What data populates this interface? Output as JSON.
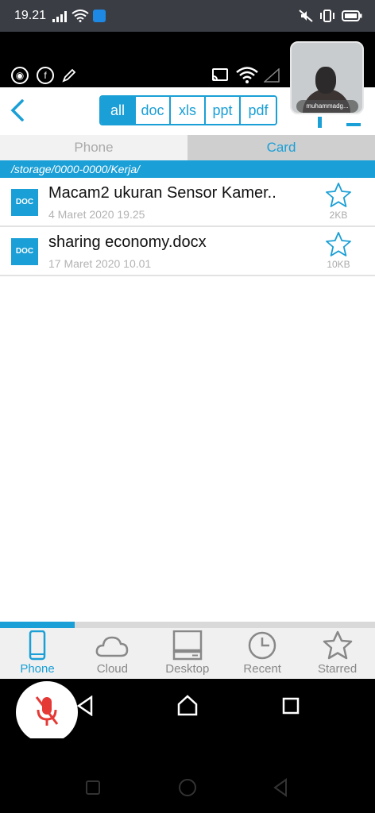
{
  "status_bar": {
    "time": "19.21"
  },
  "header": {
    "filters": [
      {
        "label": "all",
        "active": true
      },
      {
        "label": "doc",
        "active": false
      },
      {
        "label": "xls",
        "active": false
      },
      {
        "label": "ppt",
        "active": false
      },
      {
        "label": "pdf",
        "active": false
      }
    ]
  },
  "video_call": {
    "caller_name": "muhammadg..."
  },
  "tabs": {
    "phone": "Phone",
    "card": "Card"
  },
  "path": "/storage/0000-0000/Kerja/",
  "files": [
    {
      "icon_label": "DOC",
      "name": "Macam2 ukuran Sensor Kamer..",
      "date": "4 Maret 2020 19.25",
      "size": "2KB"
    },
    {
      "icon_label": "DOC",
      "name": "sharing economy.docx",
      "date": "17 Maret 2020 10.01",
      "size": "10KB"
    }
  ],
  "scroll_progress_fraction": 0.2,
  "bottom_nav": {
    "items": [
      {
        "label": "Phone",
        "icon": "phone-icon",
        "active": true
      },
      {
        "label": "Cloud",
        "icon": "cloud-icon",
        "active": false
      },
      {
        "label": "Desktop",
        "icon": "desktop-icon",
        "active": false
      },
      {
        "label": "Recent",
        "icon": "clock-icon",
        "active": false
      },
      {
        "label": "Starred",
        "icon": "star-icon",
        "active": false
      }
    ]
  },
  "colors": {
    "accent": "#1a9fd6",
    "status_bar": "#3a3d44",
    "mic_red": "#e53935"
  }
}
